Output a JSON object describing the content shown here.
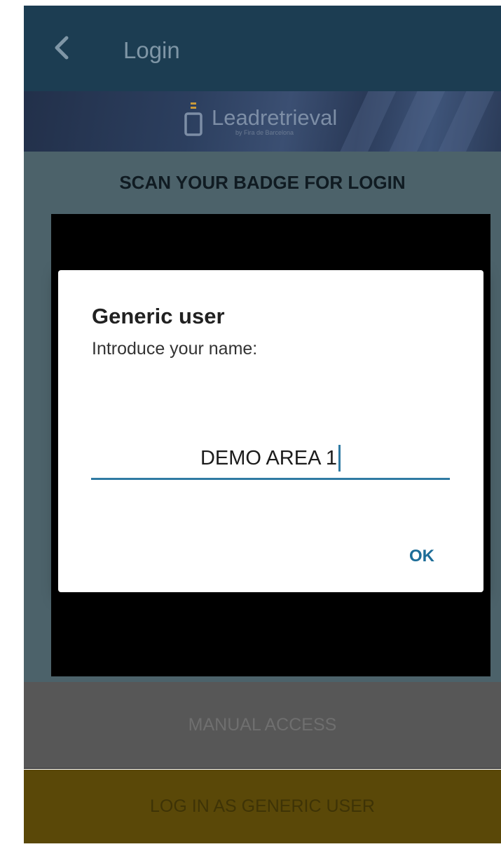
{
  "app_bar": {
    "title": "Login",
    "back_icon": "chevron-left-icon"
  },
  "banner": {
    "logo_text": "Leadretrieval",
    "logo_subtext": "by Fira de Barcelona"
  },
  "scan": {
    "title": "SCAN YOUR BADGE FOR LOGIN"
  },
  "dialog": {
    "title": "Generic user",
    "message": "Introduce your name:",
    "input_value": "DEMO AREA 1",
    "ok_label": "OK"
  },
  "buttons": {
    "manual_access": "MANUAL ACCESS",
    "generic_user": "LOG IN AS GENERIC USER"
  },
  "colors": {
    "accent": "#2f7aa3",
    "ok_text": "#1d6d98",
    "app_bar": "#1c3d52"
  }
}
